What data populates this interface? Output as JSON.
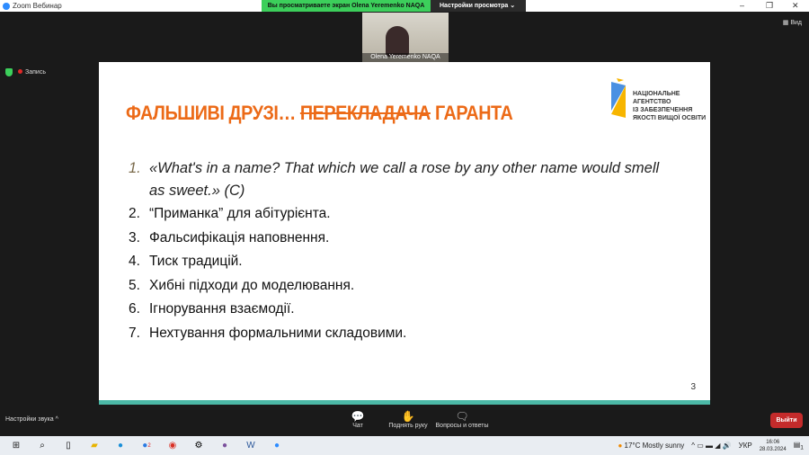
{
  "titlebar": {
    "title": "Zoom Вебинар",
    "share_banner": "Вы просматриваете экран Olena Yeremenko NAQA",
    "view_options": "Настройки просмотра"
  },
  "video": {
    "name": "Olena Yeremenko NAQA"
  },
  "view_button": "Вид",
  "recording": "Запись",
  "slide": {
    "title_part1": "ФАЛЬШИВІ ДРУЗІ… ",
    "title_struck": "ПЕРЕКЛАДАЧА",
    "title_part2": " ГАРАНТА",
    "logo_lines": [
      "НАЦІОНАЛЬНЕ",
      "АГЕНТСТВО",
      "ІЗ ЗАБЕЗПЕЧЕННЯ",
      "ЯКОСТІ ВИЩОЇ ОСВІТИ"
    ],
    "items": [
      {
        "n": "1.",
        "text": "«What's in a name? That which we call a rose by any other name would smell as sweet.» (C)"
      },
      {
        "n": "2.",
        "text": "“Приманка” для абітурієнта."
      },
      {
        "n": "3.",
        "text": "Фальсифікація наповнення."
      },
      {
        "n": "4.",
        "text": "Тиск традицій."
      },
      {
        "n": "5.",
        "text": "Хибні підходи до моделювання."
      },
      {
        "n": "6.",
        "text": "Ігнорування взаємодії."
      },
      {
        "n": "7.",
        "text": "Нехтування формальними складовими."
      }
    ],
    "page": "3"
  },
  "toolbar": {
    "sound": "Настройки звука ^",
    "chat": "Чат",
    "raise_hand": "Поднять руку",
    "qa": "Вопросы и ответы",
    "exit": "Выйти"
  },
  "taskbar": {
    "weather": "17°C  Mostly sunny",
    "lang": "УКР",
    "time": "16:06",
    "date": "28.03.2024",
    "notif": "1",
    "badge": "2"
  }
}
